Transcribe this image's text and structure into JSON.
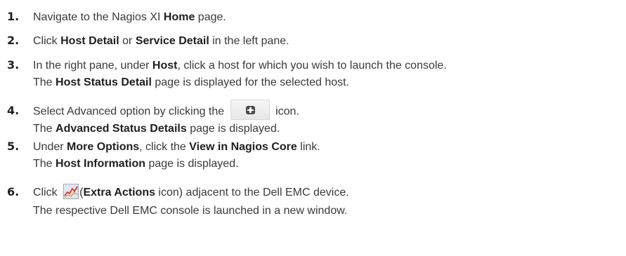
{
  "steps": [
    {
      "number": "1.",
      "lines": [
        [
          "Navigate to the Nagios XI ",
          {
            "b": "Home"
          },
          " page."
        ]
      ]
    },
    {
      "number": "2.",
      "lines": [
        [
          "Click ",
          {
            "b": "Host Detail"
          },
          " or ",
          {
            "b": "Service Detail"
          },
          " in the left pane."
        ]
      ]
    },
    {
      "number": "3.",
      "lines": [
        [
          "In the right pane, under ",
          {
            "b": "Host"
          },
          ", click a host for which you wish to launch the console."
        ],
        [
          "The ",
          {
            "b": "Host Status Detail"
          },
          " page is displayed for the selected host."
        ]
      ]
    },
    {
      "number": "4.",
      "lines": [
        [
          "Select Advanced option by clicking the ",
          {
            "icon": "plus-square-icon"
          },
          " icon."
        ],
        [
          "The ",
          {
            "b": "Advanced Status Details"
          },
          " page is displayed."
        ]
      ]
    },
    {
      "number": "5.",
      "lines": [
        [
          "Under ",
          {
            "b": "More Options"
          },
          ", click the ",
          {
            "b": "View in Nagios Core"
          },
          " link."
        ],
        [
          "The ",
          {
            "b": "Host Information"
          },
          " page is displayed."
        ]
      ]
    },
    {
      "number": "6.",
      "lines": [
        [
          "Click ",
          {
            "icon": "extra-actions-chart-icon"
          },
          "(",
          {
            "b": "Extra Actions"
          },
          " icon) adjacent to the Dell EMC device."
        ],
        [
          "The respective Dell EMC console is launched in a new window."
        ]
      ]
    }
  ]
}
